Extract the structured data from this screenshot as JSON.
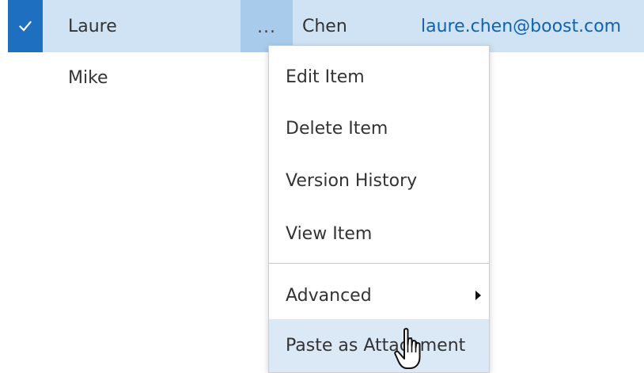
{
  "rows": [
    {
      "first_name": "Laure",
      "last_name": "Chen",
      "email": "laure.chen@boost.com",
      "selected": true
    },
    {
      "first_name": "Mike",
      "selected": false
    }
  ],
  "row_actions": {
    "ellipsis": "..."
  },
  "context_menu": {
    "items": [
      {
        "label": "Edit Item"
      },
      {
        "label": "Delete Item"
      },
      {
        "label": "Version History"
      },
      {
        "label": "View Item"
      },
      {
        "label": "Advanced",
        "has_submenu": true
      },
      {
        "label": "Paste as Attachment",
        "hovered": true
      }
    ]
  },
  "colors": {
    "selected_row": "#cfe3f5",
    "check_cell": "#1e6fbf",
    "ellipsis_hover": "#a9cbeb",
    "email_link": "#0f63b0",
    "menu_hover": "#dbe9f7"
  },
  "icons": {
    "check": "check-icon",
    "submenu": "chevron-right-icon",
    "cursor": "hand-pointer-icon"
  }
}
